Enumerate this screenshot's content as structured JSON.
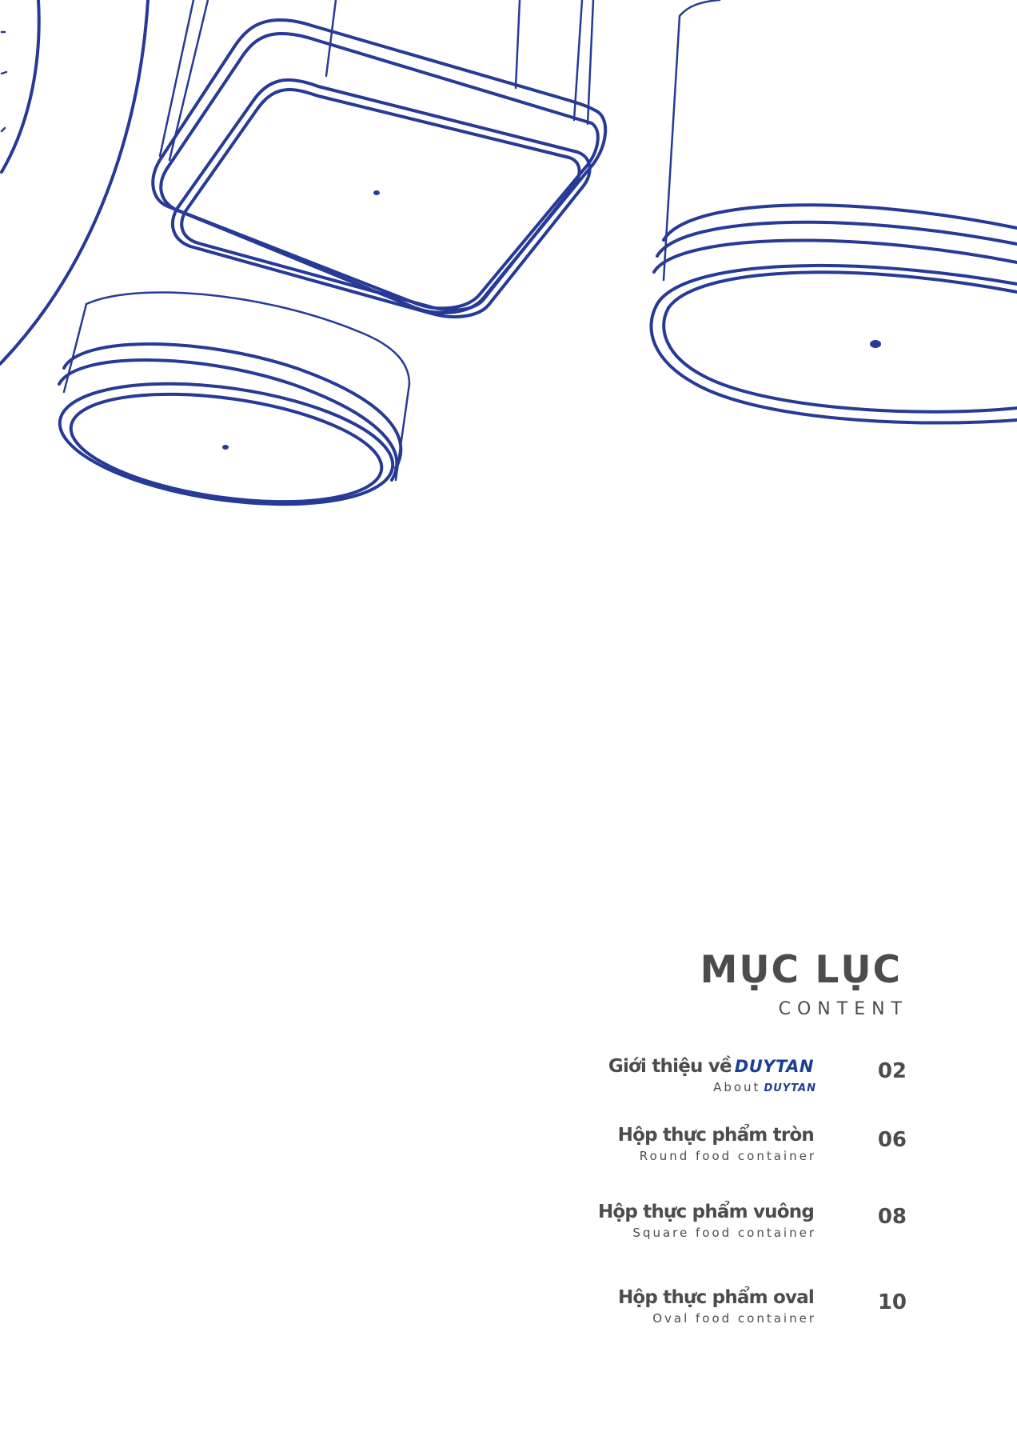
{
  "illustration": {
    "name": "food container line drawings",
    "color": "#263a96"
  },
  "contents": {
    "title": "MỤC LỤC",
    "subtitle": "CONTENT",
    "entries": [
      {
        "title": "Giới thiệu về",
        "title_brand": "DUYTAN",
        "subtitle": "About",
        "subtitle_brand": "DUYTAN",
        "page": "02"
      },
      {
        "title": "Hộp thực phẩm tròn",
        "subtitle": "Round food container",
        "page": "06"
      },
      {
        "title": "Hộp thực phẩm vuông",
        "subtitle": "Square food container",
        "page": "08"
      },
      {
        "title": "Hộp thực phẩm oval",
        "subtitle": "Oval food container",
        "page": "10"
      }
    ]
  },
  "colors": {
    "text": "#4c4c4c",
    "brand": "#1d3e94",
    "line_art": "#263a96"
  }
}
